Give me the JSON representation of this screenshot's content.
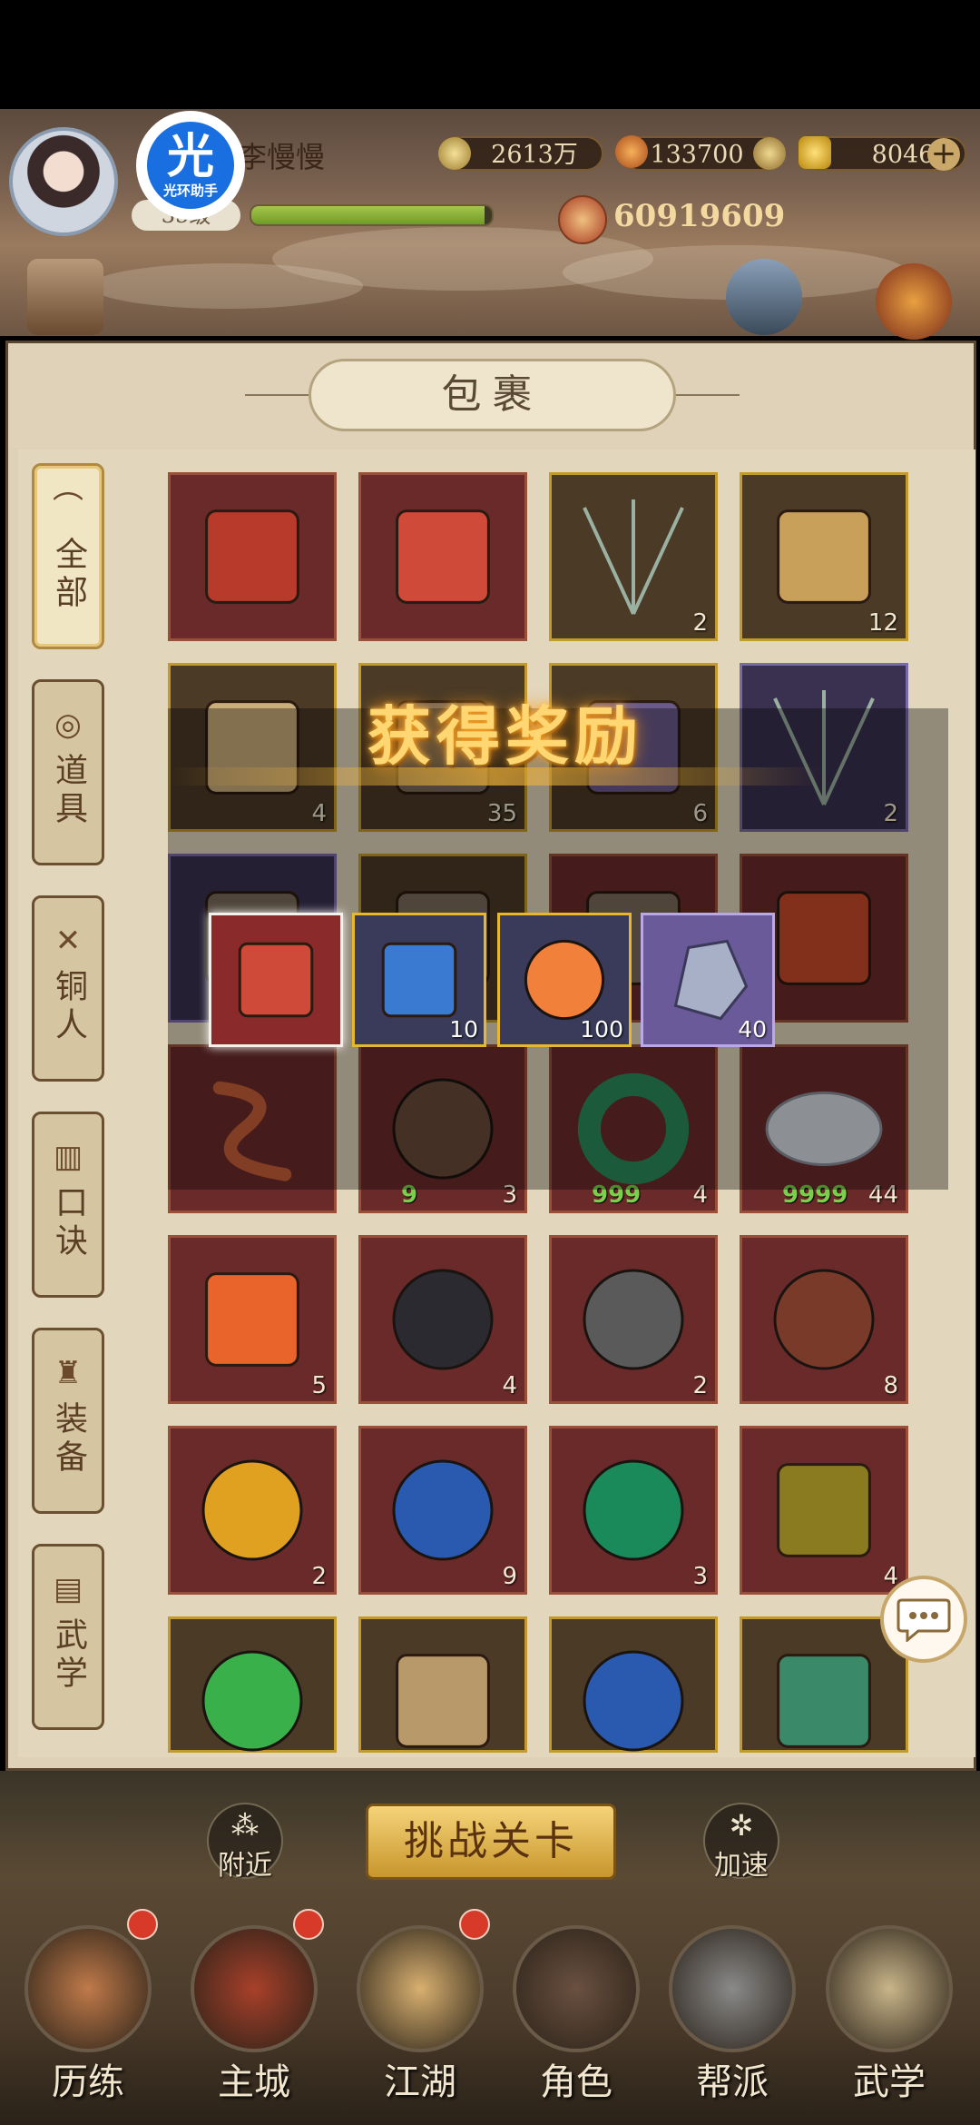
{
  "header": {
    "player_name": "李慢慢",
    "level": "35级",
    "exp_fraction": 0.97,
    "silver": "2613万",
    "ingots": "133700",
    "gold": "8046",
    "power": "60919609",
    "helper_logo": {
      "glyph": "光",
      "text": "光环助手"
    }
  },
  "panel": {
    "title": "包裹"
  },
  "tabs": [
    {
      "label": "全部",
      "icon": "fan-icon",
      "active": true
    },
    {
      "label": "道具",
      "icon": "pouch-icon",
      "active": false
    },
    {
      "label": "铜人",
      "icon": "figure-icon",
      "active": false
    },
    {
      "label": "口诀",
      "icon": "scroll-icon",
      "active": false
    },
    {
      "label": "装备",
      "icon": "armor-icon",
      "active": false
    },
    {
      "label": "武学",
      "icon": "book-icon",
      "active": false
    }
  ],
  "items": [
    {
      "icon": "red-envelope-icon",
      "frame": "red",
      "count": ""
    },
    {
      "icon": "gift-box-icon",
      "frame": "red",
      "count": ""
    },
    {
      "icon": "needles-icon",
      "frame": "gold",
      "count": "2"
    },
    {
      "icon": "treasure-table-icon",
      "frame": "gold",
      "count": "12"
    },
    {
      "icon": "scroll-map-icon",
      "frame": "gold",
      "count": "4"
    },
    {
      "icon": "item-icon",
      "frame": "gold",
      "count": "35"
    },
    {
      "icon": "manual-book-icon",
      "frame": "gold",
      "count": "6"
    },
    {
      "icon": "needles-icon",
      "frame": "purple",
      "count": "2"
    },
    {
      "icon": "item-icon",
      "frame": "purple",
      "count": ""
    },
    {
      "icon": "item-icon",
      "frame": "gold",
      "count": ""
    },
    {
      "icon": "item-icon",
      "frame": "red",
      "count": ""
    },
    {
      "icon": "token-icon",
      "frame": "red",
      "count": ""
    },
    {
      "icon": "snake-icon",
      "frame": "red",
      "count": ""
    },
    {
      "icon": "egg-icon",
      "frame": "red",
      "count": "3",
      "level": "9"
    },
    {
      "icon": "jade-ring-icon",
      "frame": "red",
      "count": "4",
      "level": "999"
    },
    {
      "icon": "cloud-stone-icon",
      "frame": "red",
      "count": "44",
      "level": "9999"
    },
    {
      "icon": "fire-card-icon",
      "frame": "red",
      "count": "5"
    },
    {
      "icon": "sword-orb-icon",
      "frame": "red",
      "count": "4"
    },
    {
      "icon": "armor-orb-icon",
      "frame": "red",
      "count": "2"
    },
    {
      "icon": "boots-orb-icon",
      "frame": "red",
      "count": "8"
    },
    {
      "icon": "gold-orb-icon",
      "frame": "red",
      "count": "2"
    },
    {
      "icon": "blue-orb-icon",
      "frame": "red",
      "count": "9"
    },
    {
      "icon": "green-orb-icon",
      "frame": "red",
      "count": "3"
    },
    {
      "icon": "amulet-icon",
      "frame": "red",
      "count": "4"
    },
    {
      "icon": "green-swirl-icon",
      "frame": "gold",
      "count": ""
    },
    {
      "icon": "book-icon",
      "frame": "gold",
      "count": ""
    },
    {
      "icon": "blue-orb-icon",
      "frame": "gold",
      "count": ""
    },
    {
      "icon": "speed-tag-icon",
      "frame": "gold",
      "count": ""
    }
  ],
  "popup": {
    "title": "获得奖励",
    "rewards": [
      {
        "icon": "gift-box-icon",
        "count": "",
        "frame": "red",
        "selected": true
      },
      {
        "icon": "gourd-icon",
        "count": "10",
        "frame": "gold"
      },
      {
        "icon": "buddha-coin-icon",
        "count": "100",
        "frame": "gold"
      },
      {
        "icon": "crystal-ore-icon",
        "count": "40",
        "frame": "purple"
      }
    ]
  },
  "actions": {
    "challenge": "挑战关卡",
    "nearby": "附近",
    "speedup": "加速"
  },
  "nav": [
    {
      "label": "历练",
      "badge": true
    },
    {
      "label": "主城",
      "badge": true
    },
    {
      "label": "江湖",
      "badge": true
    },
    {
      "label": "角色",
      "badge": false
    },
    {
      "label": "帮派",
      "badge": false
    },
    {
      "label": "武学",
      "badge": false
    }
  ],
  "colors": {
    "frame_red": "#9a5038",
    "frame_gold": "#c49a2c",
    "frame_purple": "#7b6aa8",
    "reward_title": "#ffd772",
    "exp_bar": "#8fb23a"
  }
}
